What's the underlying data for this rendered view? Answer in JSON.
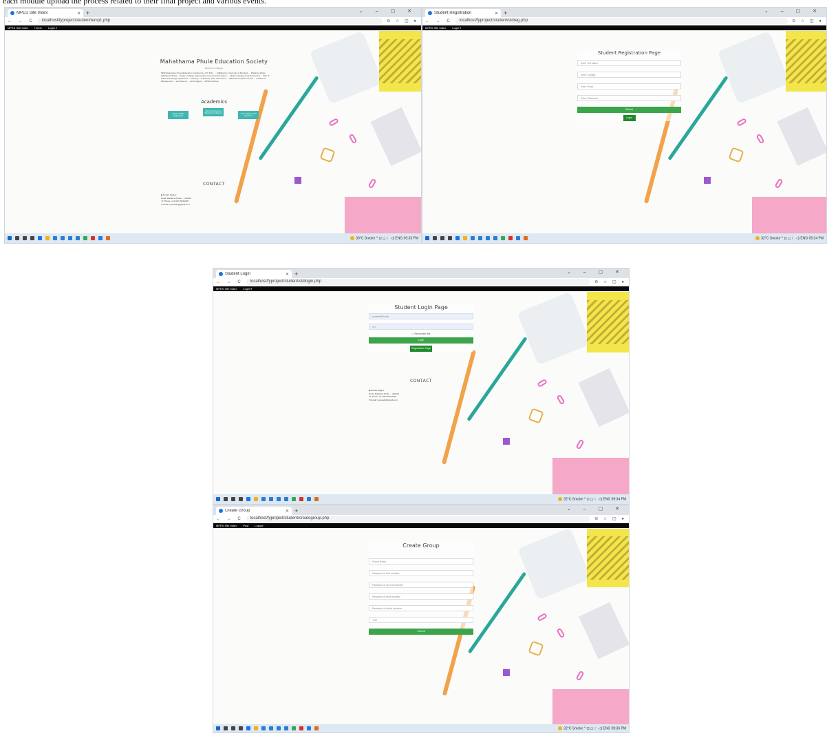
{
  "caption": "each module upload the process related to their final project and various events.",
  "window_controls": "⌄  –  ▢  ✕",
  "address_nav": "←  →  C",
  "address_ext": "⊖ ☆ ◫ ●",
  "taskbar": {
    "weather_1": "30°C Smoke",
    "weather_other": "32°C Smoke",
    "tray_1": "^ ⊡ ◻ ☾ ◁) ENG 09:33 PM",
    "tray_2": "^ ⊡ ◻ ☾ ◁) ENG 09:34 PM",
    "tray_3": "^ ⊡ ◻ ☾ ◁) ENG 09:34 PM",
    "tray_4": "^ ⊡ ◻ ☾ ◁) ENG 09:36 PM",
    "icon_colors": [
      "#1b66c9",
      "#444444",
      "#444444",
      "#444444",
      "#1a73e8",
      "#f1b21c",
      "#2b7cd3",
      "#2b7cd3",
      "#2b7cd3",
      "#2b7cd3",
      "#34a853",
      "#d93025",
      "#2b7cd3",
      "#e06c1a"
    ]
  },
  "shot1": {
    "tab_title": "MPES Site Index",
    "url": "localhost/fyproject/student/temp1.php",
    "nav": [
      "MPES Site Index",
      "Home",
      "Login ▾"
    ],
    "title": "Mahathama Phule Education Society",
    "subtitle": "Welcome to Nagpur",
    "paragraph": "MPES Education Trust (Education Institute) ALL ITI, B.Sc. ... (Affiliated to University of Mumbai) ... Mahatma Phule (Mahatma Phule) ... Degree College Engineering, Commerce Education. ... Diploma Engineering Polytechnic ... BSc IT, CS & Technology Polytechnic ... Nursing ... & Science, Arts, Commerce ... National Computer Course ... Institute of Management ... and Science ... all at Nagpur ... MPES Institute.",
    "academics": "Academics",
    "cards": [
      "Degree College Engineering",
      "Diploma Engineering Polytechnic & Science",
      "Junior College Arts & Commerce"
    ],
    "contact": "CONTACT",
    "contact_lines": [
      "■ Ambad Nagpur",
      "Road, Mahatma Phule ... 440012",
      "☏ Phone: +91 022 25412345",
      "✉ Email: mpesedu@gmail.com"
    ]
  },
  "shot2": {
    "tab_title": "Student Registration",
    "url": "localhost/fyproject/student/stdreg.php",
    "nav": [
      "MPES Site Index",
      "Login ▾"
    ],
    "title": "Student Registration Page",
    "fields": [
      "Enter Full Name",
      "Enter Contact",
      "Enter Email",
      "Enter Password"
    ],
    "submit": "Submit",
    "login": "Login"
  },
  "shot3": {
    "tab_title": "Student Login",
    "url": "localhost/fyproject/student/stdlogin.php",
    "nav": [
      "MPES Site Index",
      "Login ▾"
    ],
    "title": "Student Login Page",
    "fields": [
      "studentid/Email",
      "••••"
    ],
    "remember": "☐ Remember Me",
    "login": "Login",
    "register": "Registration Page",
    "contact": "CONTACT",
    "contact_lines": [
      "■ Ambad Nagpur",
      "Road, Mahatma Phule ... 440012",
      "☏ Phone: +91 022 25412345",
      "✉ Email: mpesedu@gmail.com"
    ]
  },
  "shot4": {
    "tab_title": "Create Group",
    "url": "localhost/fyproject/student/creategroup.php",
    "nav": [
      "MPES Site Index",
      "Post",
      "Logout"
    ],
    "title": "Create Group",
    "fields": [
      "Group Name",
      "Password of first member",
      "Password of second member",
      "Password of third member",
      "Password of fourth member",
      "Year"
    ],
    "submit": "Submit"
  }
}
